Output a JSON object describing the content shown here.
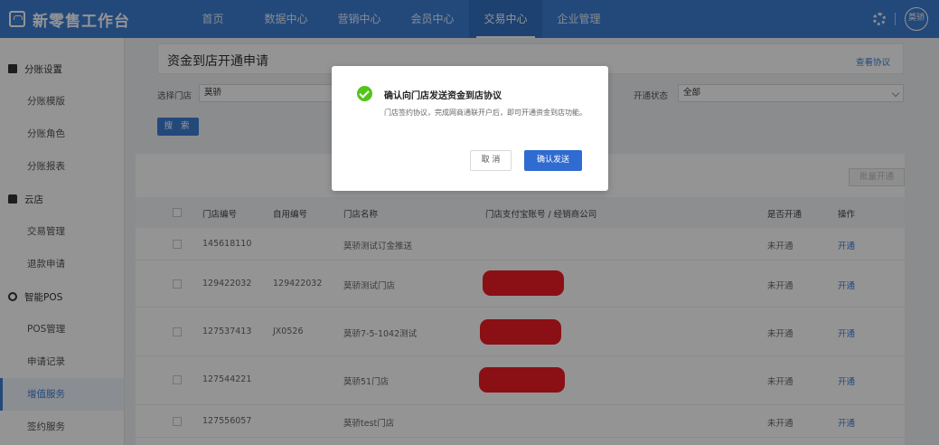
{
  "app": {
    "title": "新零售工作台",
    "user_initials": "莫骄"
  },
  "nav": [
    {
      "label": "首页"
    },
    {
      "label": "数据中心"
    },
    {
      "label": "营销中心"
    },
    {
      "label": "会员中心"
    },
    {
      "label": "交易中心"
    },
    {
      "label": "企业管理"
    }
  ],
  "sidebar": {
    "group_settings": "分账设置",
    "item_template": "分账模版",
    "item_role": "分账角色",
    "item_report": "分账报表",
    "group_cloud": "云店",
    "item_trade": "交易管理",
    "item_refund": "退款申请",
    "group_pos": "智能POS",
    "item_pos": "POS管理",
    "item_apply": "申请记录",
    "item_value": "增值服务",
    "item_sign": "签约服务"
  },
  "page": {
    "title": "资金到店开通申请",
    "view_protocol": "查看协议"
  },
  "filters": {
    "store_label": "选择门店",
    "store_value": "莫骄",
    "status_label": "开通状态",
    "status_value": "全部",
    "search_label": "搜 索"
  },
  "table": {
    "batch_label": "批量开通",
    "headers": {
      "store_no": "门店编号",
      "own_no": "自用编号",
      "store_name": "门店名称",
      "alipay": "门店支付宝账号 / 经销商公司",
      "opened": "是否开通",
      "action": "操作"
    },
    "rows": [
      {
        "store_no": "145618110",
        "own_no": "",
        "store_name": "莫骄测试订金推送",
        "opened": "未开通",
        "action": "开通"
      },
      {
        "store_no": "129422032",
        "own_no": "129422032",
        "store_name": "莫骄测试门店",
        "opened": "未开通",
        "action": "开通"
      },
      {
        "store_no": "127537413",
        "own_no": "JX0526",
        "store_name": "莫骄7-5-1042测试",
        "opened": "未开通",
        "action": "开通"
      },
      {
        "store_no": "127544221",
        "own_no": "",
        "store_name": "莫骄51门店",
        "opened": "未开通",
        "action": "开通"
      },
      {
        "store_no": "127556057",
        "own_no": "",
        "store_name": "莫骄test门店",
        "opened": "未开通",
        "action": "开通"
      }
    ]
  },
  "modal": {
    "title": "确认向门店发送资金到店协议",
    "text": "门店签约协议，完成网商通联开户后，即可开通资金到店功能。",
    "cancel_label": "取 消",
    "confirm_label": "确认发送"
  },
  "colors": {
    "brand": "#3d7fd4",
    "redaction": "#ee1c25",
    "success": "#52c41a"
  }
}
